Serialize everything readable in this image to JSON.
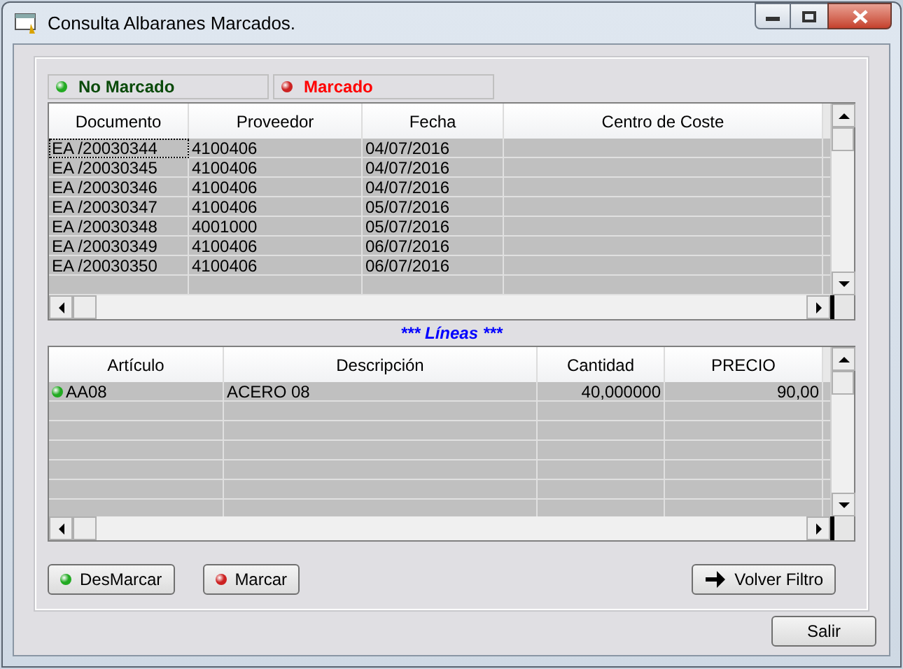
{
  "window": {
    "title": "Consulta Albaranes Marcados."
  },
  "legend": [
    {
      "label": "No Marcado",
      "color": "#22aa22"
    },
    {
      "label": "Marcado",
      "color": "#cc2222"
    }
  ],
  "documents": {
    "columns": [
      "Documento",
      "Proveedor",
      "Fecha",
      "Centro de Coste"
    ],
    "rows": [
      {
        "cells": [
          "EA /20030344",
          "4100406",
          "04/07/2016",
          ""
        ],
        "focused": true
      },
      {
        "cells": [
          "EA /20030345",
          "4100406",
          "04/07/2016",
          ""
        ],
        "focused": false
      },
      {
        "cells": [
          "EA /20030346",
          "4100406",
          "04/07/2016",
          ""
        ],
        "focused": false
      },
      {
        "cells": [
          "EA /20030347",
          "4100406",
          "05/07/2016",
          ""
        ],
        "focused": false
      },
      {
        "cells": [
          "EA /20030348",
          "4001000",
          "05/07/2016",
          ""
        ],
        "focused": false
      },
      {
        "cells": [
          "EA /20030349",
          "4100406",
          "06/07/2016",
          ""
        ],
        "focused": false
      },
      {
        "cells": [
          "EA /20030350",
          "4100406",
          "06/07/2016",
          ""
        ],
        "focused": false
      }
    ]
  },
  "lines_title": "*** Líneas ***",
  "lines": {
    "columns": [
      "Artículo",
      "Descripción",
      "Cantidad",
      "PRECIO"
    ],
    "rows": [
      {
        "cells": [
          "AA08",
          "ACERO 08",
          "40,000000",
          "90,00"
        ],
        "color": "#22aa22"
      }
    ]
  },
  "buttons": [
    {
      "label": "DesMarcar",
      "kind": "unmark"
    },
    {
      "label": "Marcar",
      "kind": "mark"
    },
    {
      "label": "Volver Filtro",
      "kind": "back"
    }
  ],
  "exit_button": "Salir"
}
